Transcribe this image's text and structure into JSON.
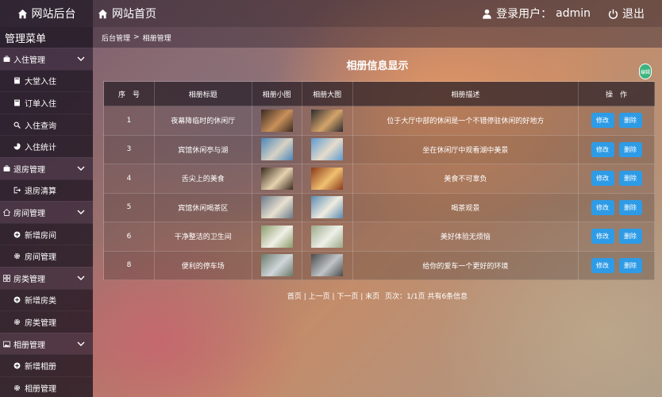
{
  "topbar": {
    "brand": "网站后台",
    "home": "网站首页",
    "user_prefix": "登录用户：",
    "user_name": "admin",
    "logout": "退出"
  },
  "sidebar": {
    "title": "管理菜单",
    "groups": [
      {
        "label": "入住管理",
        "icon": "suitcase-icon",
        "items": [
          {
            "label": "大堂入住",
            "icon": "book-icon"
          },
          {
            "label": "订单入住",
            "icon": "book-icon"
          },
          {
            "label": "入住查询",
            "icon": "search-icon"
          },
          {
            "label": "入住统计",
            "icon": "pie-chart-icon"
          }
        ]
      },
      {
        "label": "退房管理",
        "icon": "suitcase-icon",
        "items": [
          {
            "label": "退房清算",
            "icon": "sign-out-icon"
          }
        ]
      },
      {
        "label": "房间管理",
        "icon": "home-icon",
        "items": [
          {
            "label": "新增房间",
            "icon": "plus-circle-icon"
          },
          {
            "label": "房间管理",
            "icon": "gear-icon"
          }
        ]
      },
      {
        "label": "房类管理",
        "icon": "grid-icon",
        "items": [
          {
            "label": "新增房类",
            "icon": "plus-circle-icon"
          },
          {
            "label": "房类管理",
            "icon": "gear-icon"
          }
        ]
      },
      {
        "label": "相册管理",
        "icon": "image-icon",
        "items": [
          {
            "label": "新增相册",
            "icon": "plus-circle-icon"
          },
          {
            "label": "相册管理",
            "icon": "gear-icon"
          }
        ]
      }
    ]
  },
  "breadcrumb": {
    "root": "后台管理",
    "separator": ">",
    "current": "相册管理"
  },
  "page_title": "相册信息显示",
  "badge": "编辑",
  "table": {
    "headers": [
      "序　号",
      "相册标题",
      "相册小图",
      "相册大图",
      "相册描述",
      "操　作"
    ],
    "rows": [
      {
        "id": "1",
        "title": "夜幕降临时的休闲厅",
        "desc": "位于大厅中部的休闲是一个不错停驻休闲的好地方",
        "small": [
          "#3b2a22",
          "#c9905a"
        ],
        "large": [
          "#2c2a30",
          "#d4a46a"
        ]
      },
      {
        "id": "3",
        "title": "宾馆休闲亭与湖",
        "desc": "坐在休闲厅中观看湖中美景",
        "small": [
          "#4a86b8",
          "#d8d2c4"
        ],
        "large": [
          "#5c9ad0",
          "#e6dccb"
        ]
      },
      {
        "id": "4",
        "title": "舌尖上的美食",
        "desc": "美食不可辜负",
        "small": [
          "#3a2a1e",
          "#e6d2b0"
        ],
        "large": [
          "#8a3a1a",
          "#f0c070"
        ]
      },
      {
        "id": "5",
        "title": "宾馆休闲喝茶区",
        "desc": "喝茶观景",
        "small": [
          "#6a7a8a",
          "#e8e0d0"
        ],
        "large": [
          "#5a8ab0",
          "#f0ece0"
        ]
      },
      {
        "id": "6",
        "title": "干净整洁的卫生间",
        "desc": "美好体验无烦恼",
        "small": [
          "#8a9a6a",
          "#f0f0e6"
        ],
        "large": [
          "#9aa888",
          "#eef0e8"
        ]
      },
      {
        "id": "8",
        "title": "便利的停车场",
        "desc": "给你的爱车一个更好的环境",
        "small": [
          "#6a7a6a",
          "#d0d6da"
        ],
        "large": [
          "#4a4a4a",
          "#c0c4c8"
        ]
      }
    ],
    "edit_label": "修改",
    "delete_label": "删除"
  },
  "pager": {
    "first": "首页",
    "prev": "上一页",
    "next": "下一页",
    "last": "末页",
    "info_prefix": "页次：",
    "page_info": "1/1页",
    "total": "共有6条信息"
  },
  "colors": {
    "button": "#2e9be6",
    "badge": "#3fb37f"
  }
}
